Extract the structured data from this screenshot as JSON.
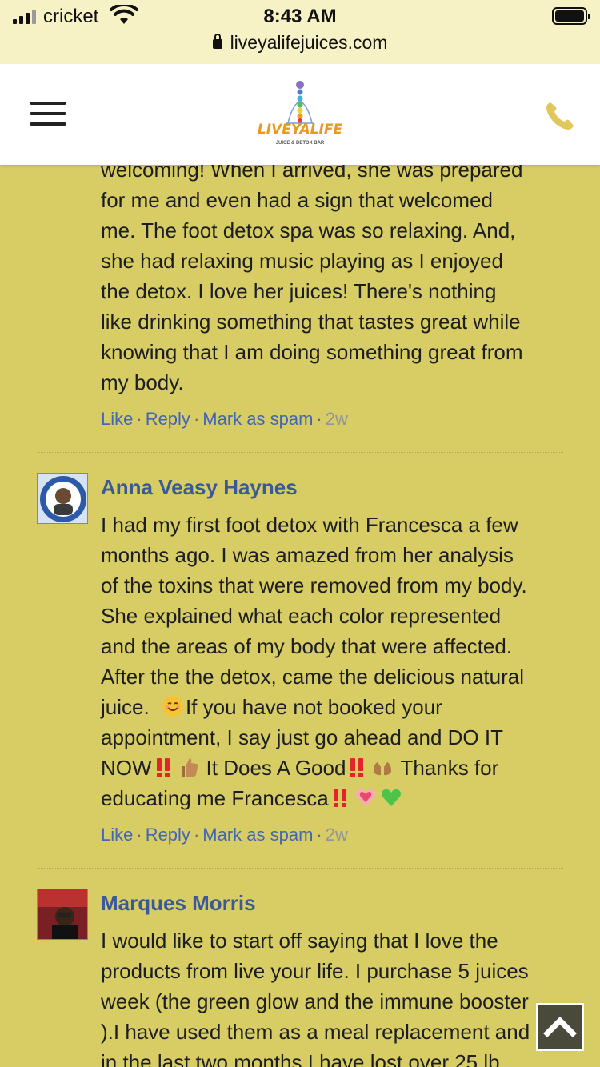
{
  "status_bar": {
    "carrier": "cricket",
    "time": "8:43 AM",
    "url": "liveyalifejuices.com"
  },
  "header": {
    "logo_text": "LIVEYALIFE",
    "logo_sub": "JUICE & DETOX BAR",
    "menu_icon": "hamburger-menu-icon",
    "phone_icon": "phone-icon"
  },
  "comments": [
    {
      "author": "",
      "lines": [
        "welcoming! When I arrived, she was prepared",
        "for me and even had a sign that welcomed",
        "me. The foot detox spa was so relaxing. And,",
        "she had relaxing music playing as I enjoyed",
        "the detox. I love her juices! There's nothing",
        "like drinking something that tastes great while",
        "knowing that I am doing something great from",
        "my body."
      ],
      "actions": {
        "like": "Like",
        "reply": "Reply",
        "spam": "Mark as spam",
        "age": "2w"
      }
    },
    {
      "author": "Anna Veasy Haynes",
      "lines": [
        "I had my first foot detox with Francesca a few",
        "months ago. I was amazed from her analysis",
        "of the toxins that were removed from my body.",
        "She explained what each color represented",
        "and the areas of my body that were affected.",
        "After the the detox, came the delicious natural",
        "juice.",
        "If you have not booked your",
        "appointment, I say just go ahead and DO IT",
        "NOW",
        "It Does A Good",
        "Thanks for",
        "educating me Francesca"
      ],
      "actions": {
        "like": "Like",
        "reply": "Reply",
        "spam": "Mark as spam",
        "age": "2w"
      }
    },
    {
      "author": "Marques Morris",
      "lines": [
        "I would like to start off saying that I love the",
        "products from live your life. I purchase 5 juices",
        "week (the green glow and the immune booster",
        ").I have used them as a meal replacement and",
        "in the last two months I have lost over 25 lb"
      ]
    }
  ],
  "colors": {
    "page_bg": "#d8cd64",
    "link": "#3b5998",
    "text": "#1c1e21"
  }
}
